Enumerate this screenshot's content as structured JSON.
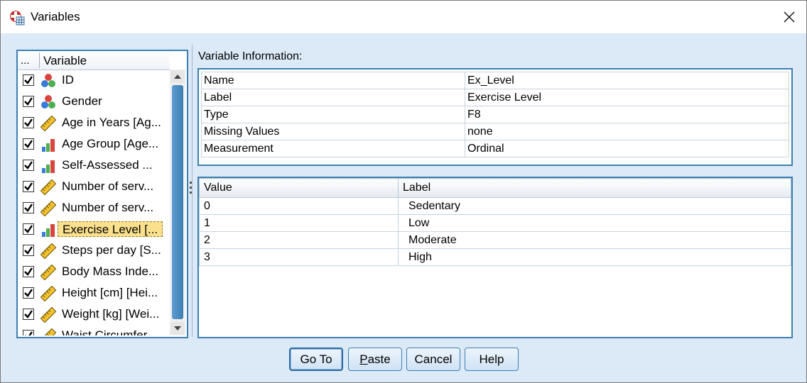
{
  "window": {
    "title": "Variables"
  },
  "variable_list": {
    "header_dots": "...",
    "header_title": "Variable",
    "items": [
      {
        "label": "ID",
        "icon": "nominal-icon",
        "checked": true
      },
      {
        "label": "Gender",
        "icon": "nominal-icon",
        "checked": true
      },
      {
        "label": "Age in Years [Ag...",
        "icon": "scale-icon",
        "checked": true
      },
      {
        "label": "Age Group [Age...",
        "icon": "ordinal-icon",
        "checked": true
      },
      {
        "label": "Self-Assessed ...",
        "icon": "ordinal-icon",
        "checked": true
      },
      {
        "label": "Number of serv...",
        "icon": "scale-icon",
        "checked": true
      },
      {
        "label": "Number of serv...",
        "icon": "scale-icon",
        "checked": true
      },
      {
        "label": "Exercise Level [...",
        "icon": "ordinal-icon",
        "checked": true,
        "selected": true
      },
      {
        "label": "Steps per day [S...",
        "icon": "scale-icon",
        "checked": true
      },
      {
        "label": "Body Mass Inde...",
        "icon": "scale-icon",
        "checked": true
      },
      {
        "label": "Height [cm] [Hei...",
        "icon": "scale-icon",
        "checked": true
      },
      {
        "label": "Weight [kg] [Wei...",
        "icon": "scale-icon",
        "checked": true
      },
      {
        "label": "Waist Circumfer...",
        "icon": "scale-icon",
        "checked": true
      }
    ]
  },
  "info": {
    "heading": "Variable Information:",
    "rows": [
      {
        "key": "Name",
        "value": "Ex_Level"
      },
      {
        "key": "Label",
        "value": "Exercise Level"
      },
      {
        "key": "Type",
        "value": "F8"
      },
      {
        "key": "Missing Values",
        "value": "none"
      },
      {
        "key": "Measurement",
        "value": "Ordinal"
      }
    ]
  },
  "values": {
    "col_value": "Value",
    "col_label": "Label",
    "rows": [
      {
        "value": "0",
        "label": "Sedentary"
      },
      {
        "value": "1",
        "label": "Low"
      },
      {
        "value": "2",
        "label": "Moderate"
      },
      {
        "value": "3",
        "label": "High"
      }
    ]
  },
  "buttons": {
    "goto": "Go To",
    "paste_u": "P",
    "paste_rest": "aste",
    "cancel": "Cancel",
    "help": "Help"
  },
  "colors": {
    "accent": "#3c7fb1",
    "background": "#dce9f7",
    "selection": "#fbe18e"
  }
}
